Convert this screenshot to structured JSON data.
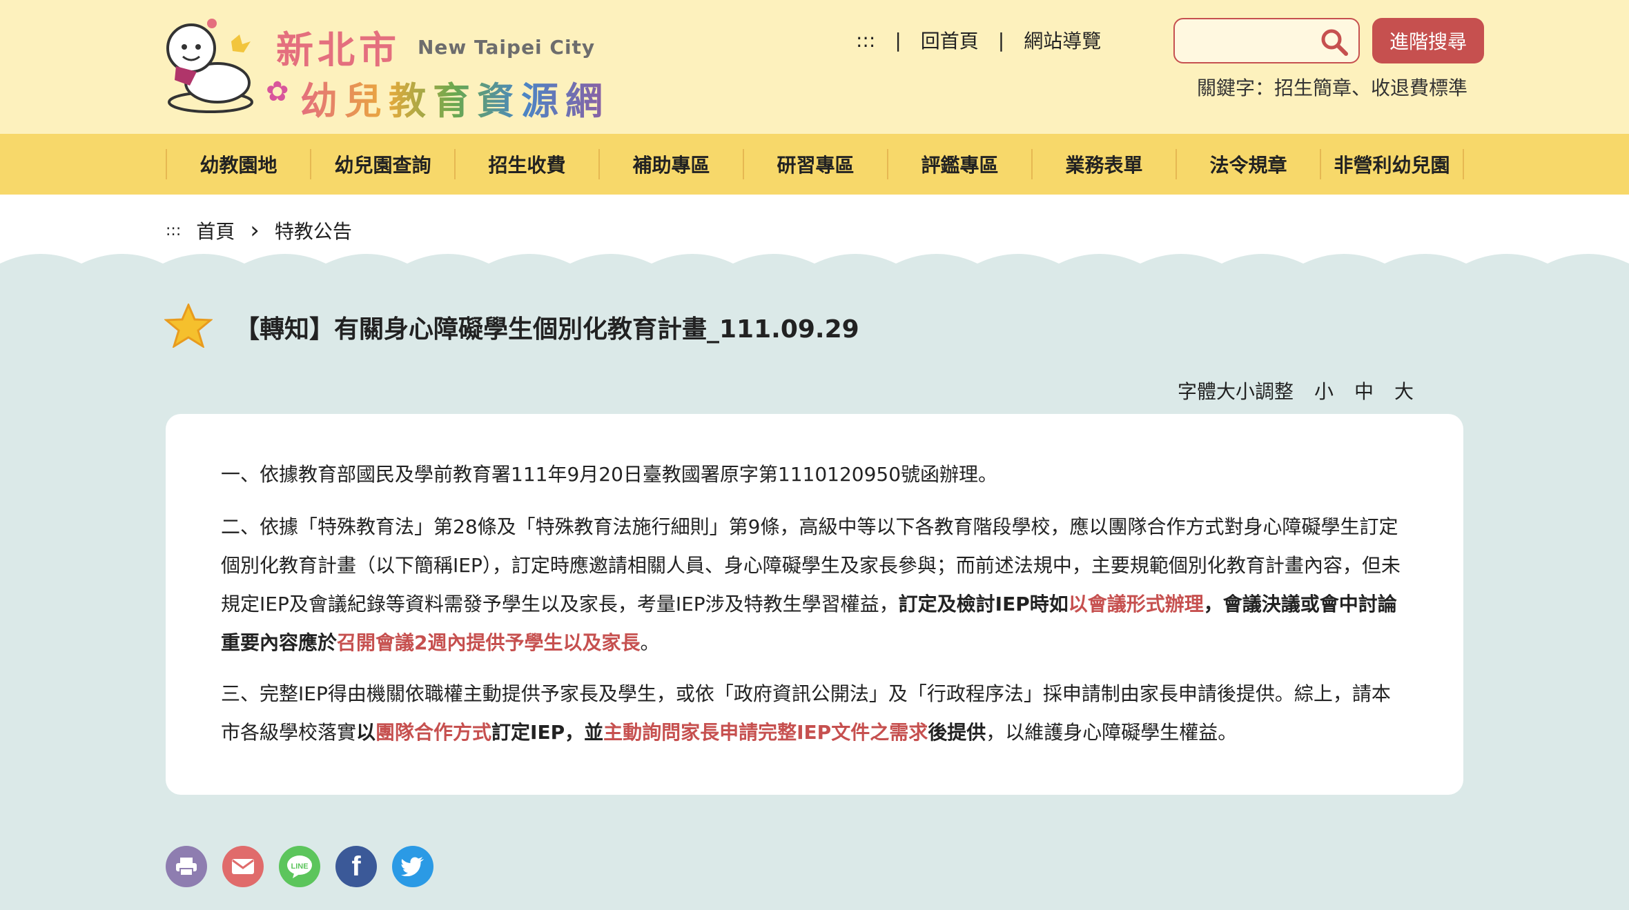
{
  "site": {
    "logo_zh_top": "新北市",
    "logo_en": "New Taipei City",
    "logo_zh_bottom": "幼兒教育資源網"
  },
  "toplinks": {
    "accesskey": ":::",
    "home": "回首頁",
    "sitemap": "網站導覽",
    "separator": "|"
  },
  "search": {
    "placeholder": "",
    "advanced_label": "進階搜尋",
    "keywords_text": "關鍵字：招生簡章、收退費標準"
  },
  "nav": {
    "items": [
      "幼教園地",
      "幼兒園查詢",
      "招生收費",
      "補助專區",
      "研習專區",
      "評鑑專區",
      "業務表單",
      "法令規章",
      "非營利幼兒園"
    ]
  },
  "breadcrumb": {
    "accesskey": ":::",
    "home": "首頁",
    "arrow": "›",
    "current": "特教公告"
  },
  "article": {
    "title": "【轉知】有關身心障礙學生個別化教育計畫_111.09.29",
    "p1": "一、依據教育部國民及學前教育署111年9月20日臺教國署原字第1110120950號函辦理。",
    "p2_a": "二、依據「特殊教育法」第28條及「特殊教育法施行細則」第9條，高級中等以下各教育階段學校，應以團隊合作方式對身心障礙學生訂定個別化教育計畫（以下簡稱IEP），訂定時應邀請相關人員、身心障礙學生及家長參與；而前述法規中，主要規範個別化教育計畫內容，但未規定IEP及會議紀錄等資料需發予學生以及家長，考量IEP涉及特教生學習權益，",
    "p2_b": "訂定及檢討IEP時如",
    "p2_c": "以會議形式辦理",
    "p2_d": "，會議決議或會中討論重要內容應於",
    "p2_e": "召開會議2週內提供予學生以及家長",
    "p2_f": "。",
    "p3_a": "三、完整IEP得由機關依職權主動提供予家長及學生，或依「政府資訊公開法」及「行政程序法」採申請制由家長申請後提供。綜上，請本市各級學校落實",
    "p3_b": "以",
    "p3_c": "團隊合作方式",
    "p3_d": "訂定IEP，並",
    "p3_e": "主動詢問家長申請完整IEP文件之需求",
    "p3_f": "後提供",
    "p3_g": "，以維護身心障礙學生權益。"
  },
  "fontsize": {
    "label": "字體大小調整",
    "small": "小",
    "medium": "中",
    "large": "大"
  },
  "share": {
    "line_text": "LINE",
    "facebook_text": "f"
  },
  "colors": {
    "header_bg": "#fdf1bd",
    "nav_bg": "#f7d86a",
    "accent_red": "#c6504f",
    "page_bg": "#dbe9e8"
  }
}
